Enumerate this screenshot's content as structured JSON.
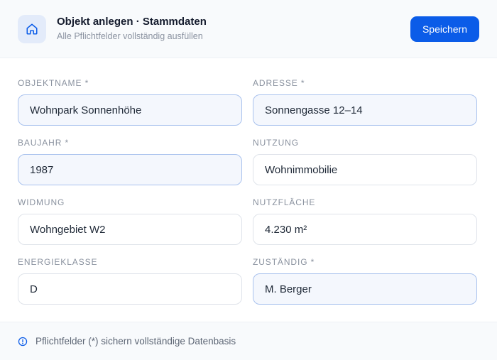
{
  "header": {
    "icon": "home-icon",
    "title": "Objekt anlegen · Stammdaten",
    "subtitle": "Alle Pflichtfelder vollständig ausfüllen",
    "save_label": "Speichern"
  },
  "colors": {
    "accent": "#0b5ce8",
    "icon_bg": "#e3ebfa",
    "required_border": "#a9c2ee",
    "required_bg": "#f4f7fd"
  },
  "fields": [
    {
      "label": "OBJEKTNAME *",
      "value": "Wohnpark Sonnenhöhe",
      "required": true
    },
    {
      "label": "ADRESSE *",
      "value": "Sonnengasse 12–14",
      "required": true
    },
    {
      "label": "BAUJAHR *",
      "value": "1987",
      "required": true
    },
    {
      "label": "NUTZUNG",
      "value": "Wohnimmobilie",
      "required": false
    },
    {
      "label": "WIDMUNG",
      "value": "Wohngebiet W2",
      "required": false
    },
    {
      "label": "NUTZFLÄCHE",
      "value": "4.230 m²",
      "required": false
    },
    {
      "label": "ENERGIEKLASSE",
      "value": "D",
      "required": false
    },
    {
      "label": "ZUSTÄNDIG *",
      "value": "M. Berger",
      "required": true
    }
  ],
  "footer": {
    "icon": "info-icon",
    "text": "Pflichtfelder (*) sichern vollständige Datenbasis"
  }
}
